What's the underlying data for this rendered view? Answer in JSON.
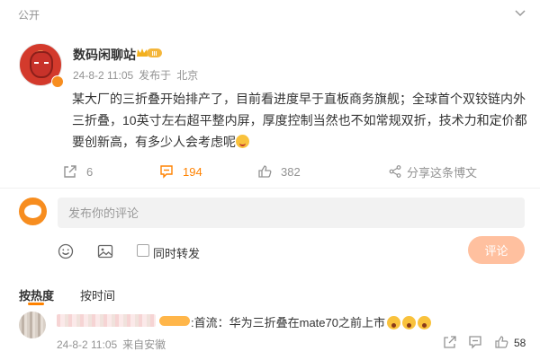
{
  "visibility": "公开",
  "post": {
    "author": "数码闲聊站",
    "badge_text": "III",
    "date": "24-8-2 11:05",
    "location_prefix": "发布于",
    "location": "北京",
    "text": "某大厂的三折叠开始排产了，目前看进度早于直板商务旗舰；全球首个双铰链内外三折叠，10英寸左右超平整内屏，厚度控制当然也不如常规双折，技术力和定价都要创新高，有多少人会考虑呢",
    "actions": {
      "forward_count": "6",
      "comment_count": "194",
      "like_count": "382",
      "share_label": "分享这条博文"
    }
  },
  "composer": {
    "placeholder": "发布你的评论",
    "also_forward_label": "同时转发",
    "submit_label": "评论"
  },
  "sort_tabs": {
    "hot": "按热度",
    "time": "按时间"
  },
  "comment": {
    "text": ":首流：华为三折叠在mate70之前上市",
    "date": "24-8-2 11:05",
    "source": "来自安徽",
    "like_count": "58"
  },
  "colors": {
    "accent": "#ff8200",
    "meta": "#939393",
    "submit_disabled": "#ffc09f"
  }
}
